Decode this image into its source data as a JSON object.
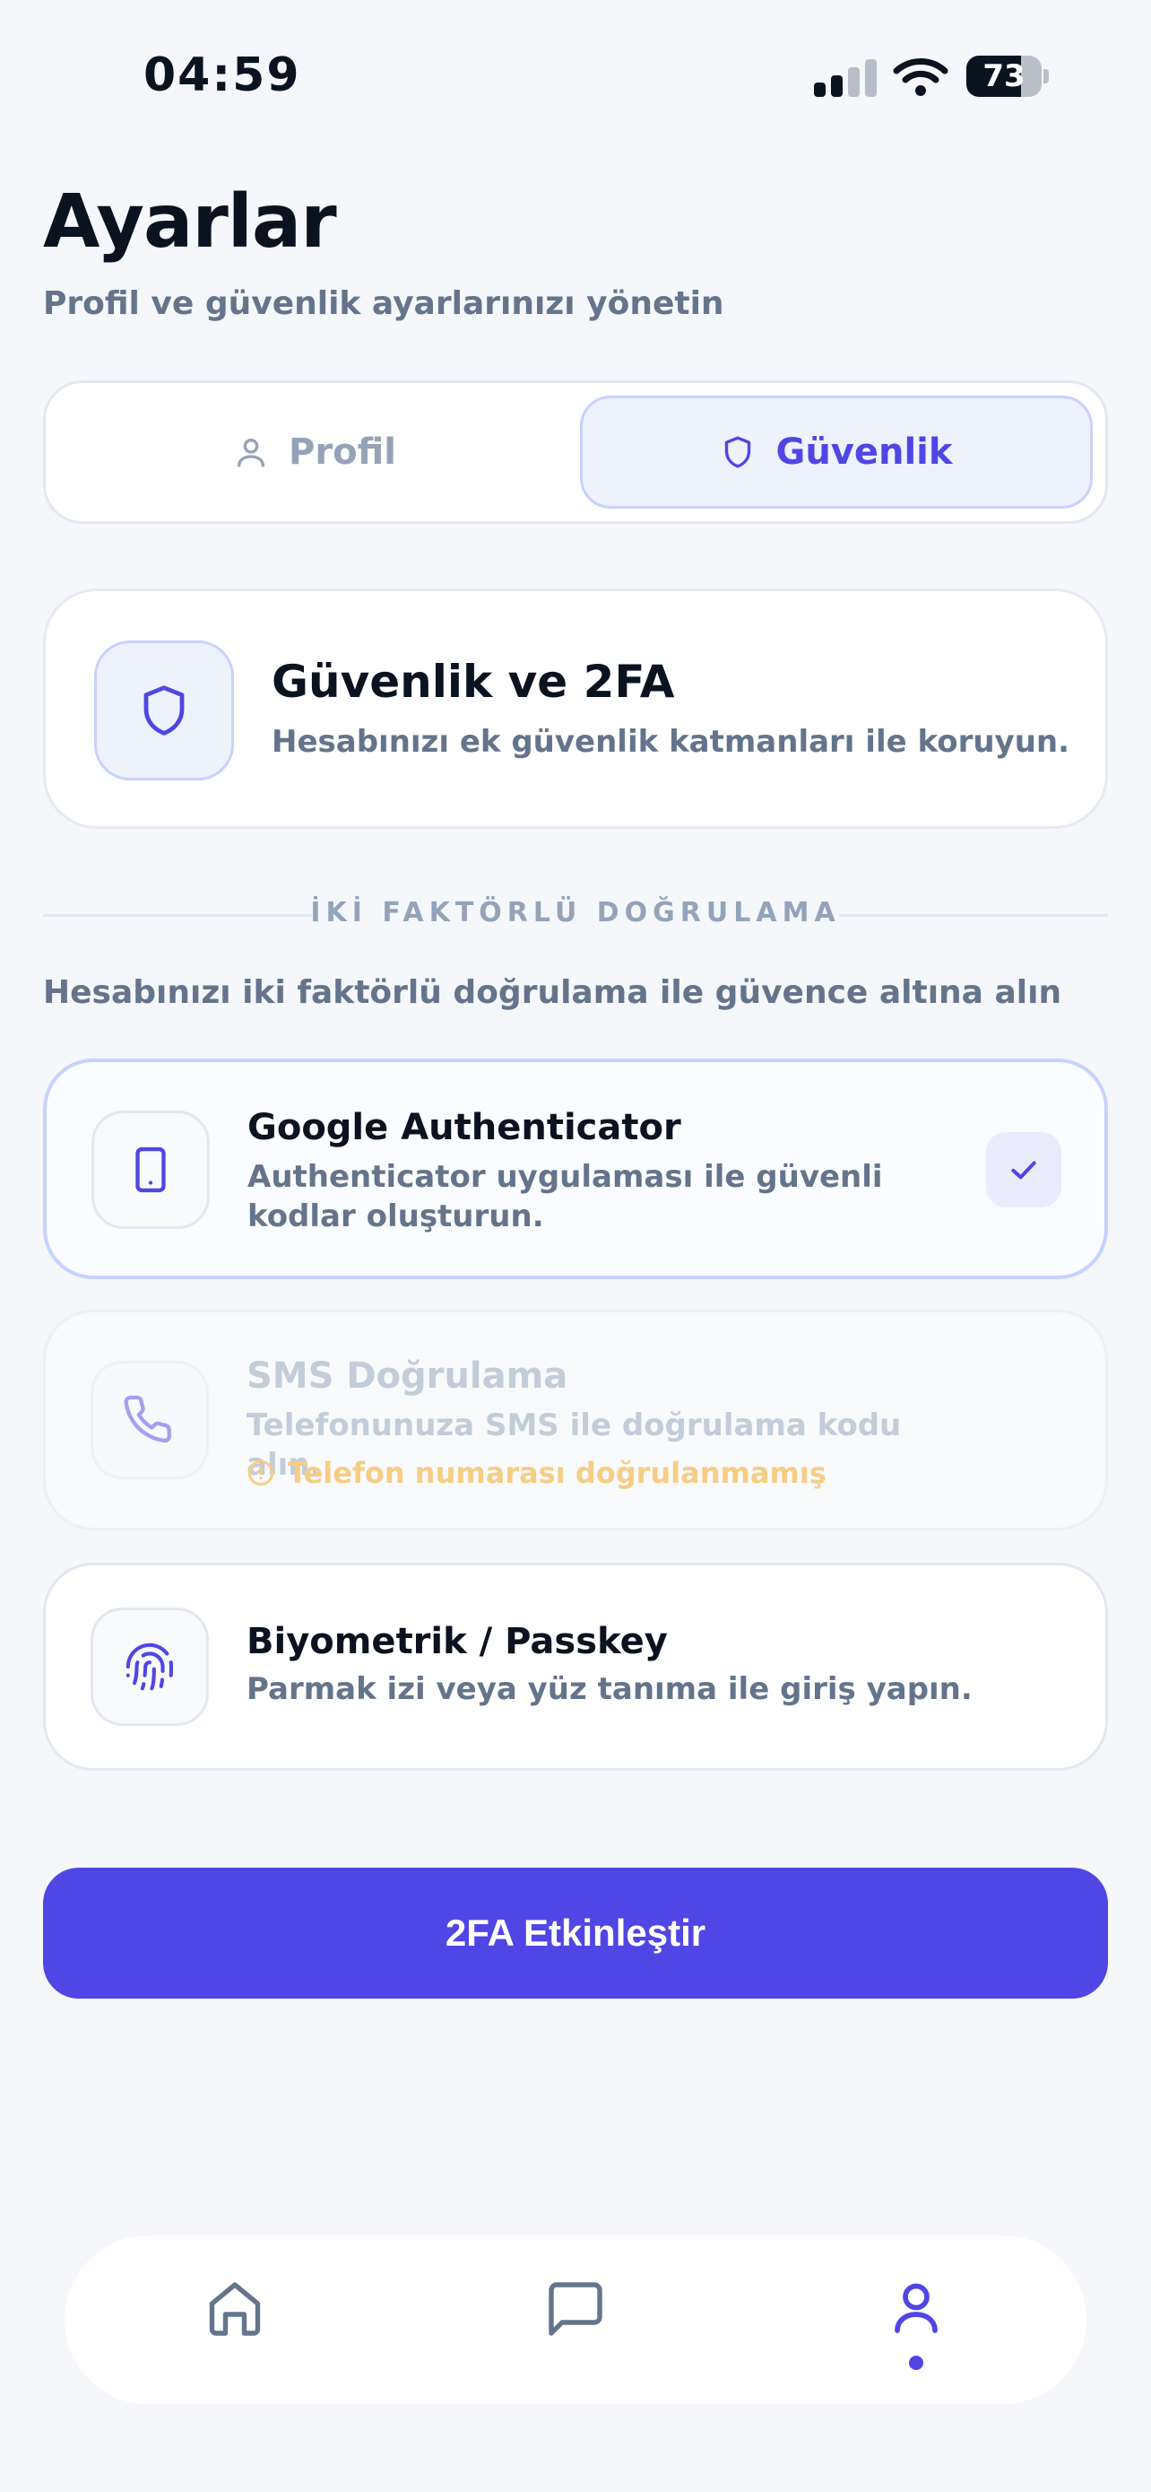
{
  "status_bar": {
    "time": "04:59",
    "battery": "73",
    "battery_level": 0.73
  },
  "header": {
    "title": "Ayarlar",
    "subtitle": "Profil ve güvenlik ayarlarınızı yönetin"
  },
  "tabs": {
    "profile_label": "Profil",
    "security_label": "Güvenlik",
    "active": "security"
  },
  "security_card": {
    "title": "Güvenlik ve 2FA",
    "description": "Hesabınızı ek güvenlik katmanları ile koruyun."
  },
  "two_factor": {
    "section_label": "İKİ FAKTÖRLÜ DOĞRULAMA",
    "section_description": "Hesabınızı iki faktörlü doğrulama ile güvence altına alın",
    "options": [
      {
        "title": "Google Authenticator",
        "description": "Authenticator uygulaması ile güvenli kodlar oluşturun.",
        "icon": "tablet-icon",
        "selected": true
      },
      {
        "title": "SMS Doğrulama",
        "description": "Telefonunuza SMS ile doğrulama kodu alın.",
        "warning": "Telefon numarası doğrulanmamış",
        "icon": "phone-icon",
        "disabled": true
      },
      {
        "title": "Biyometrik / Passkey",
        "description": "Parmak izi veya yüz tanıma ile giriş yapın.",
        "icon": "fingerprint-icon"
      }
    ]
  },
  "actions": {
    "enable_2fa_label": "2FA Etkinleştir"
  },
  "bottom_nav": {
    "items": [
      "home-icon",
      "chat-icon",
      "profile-icon"
    ],
    "active": "profile"
  },
  "colors": {
    "accent": "#5046e5",
    "accent_soft": "#eef2fd",
    "warning": "#f6cd84",
    "muted_text": "#64748b"
  }
}
